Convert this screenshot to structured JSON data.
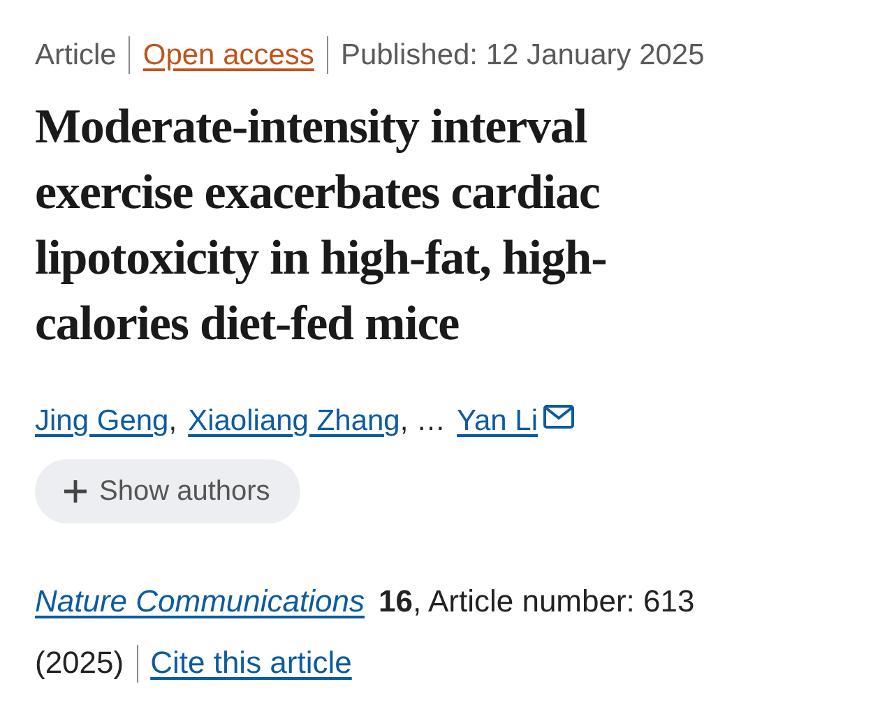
{
  "meta": [
    {
      "kind": "text",
      "text": "Article"
    },
    {
      "kind": "link",
      "text": "Open access"
    },
    {
      "kind": "text",
      "text": "Published: 12 January 2025"
    }
  ],
  "title": "Moderate-intensity interval exercise exacerbates cardiac lipotoxicity in high-fat, high-calories diet-fed mice",
  "authors": [
    {
      "name": "Jing Geng",
      "separator": ",",
      "email": false
    },
    {
      "name": "Xiaoliang Zhang",
      "separator": ", …",
      "email": false
    },
    {
      "name": "Yan Li",
      "email": true
    }
  ],
  "show_authors": {
    "label": "Show authors"
  },
  "citation": {
    "journal": "Nature Communications",
    "details": "**16**, Article number: 613",
    "year": "(2025)",
    "cite_link": "Cite this article"
  }
}
